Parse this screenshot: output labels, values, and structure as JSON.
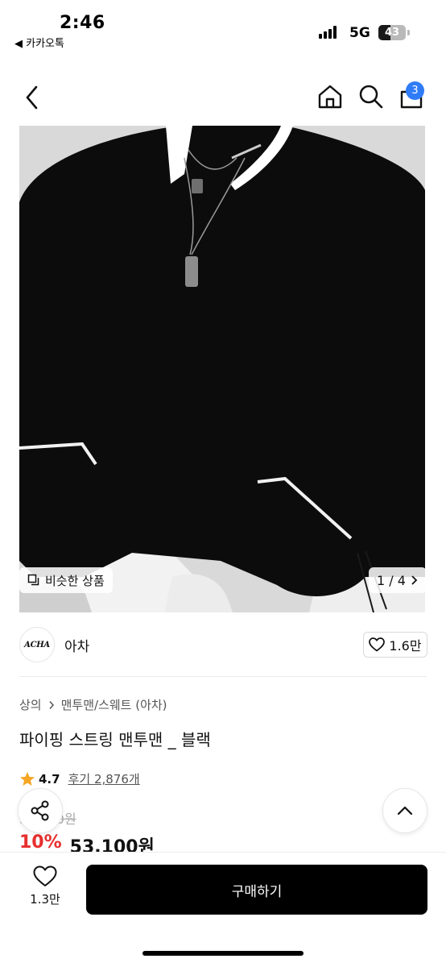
{
  "status_bar": {
    "time": "2:46",
    "back_app": "◀ 카카오톡",
    "network": "5G",
    "battery": "43",
    "battery_level": 0.43
  },
  "nav": {
    "cart_count": "3"
  },
  "gallery": {
    "similar_label": "비슷한 상품",
    "page_counter": "1 / 4"
  },
  "brand": {
    "logo_text": "ACHA",
    "name": "아차",
    "likes": "1.6만"
  },
  "breadcrumb": {
    "category": "상의",
    "subcategory": "맨투맨/스웨트 (아차)"
  },
  "product": {
    "title": "파이핑 스트링 맨투맨 _ 블랙",
    "rating": "4.7",
    "reviews": "후기 2,876개",
    "original_price": "59,000원",
    "discount": "10%",
    "price": "53,100원"
  },
  "bottom_bar": {
    "wish_count": "1.3만",
    "buy_label": "구매하기"
  },
  "colors": {
    "accent_blue": "#2f7cf6",
    "discount_red": "#e82e2e",
    "buy_button": "#000000"
  }
}
